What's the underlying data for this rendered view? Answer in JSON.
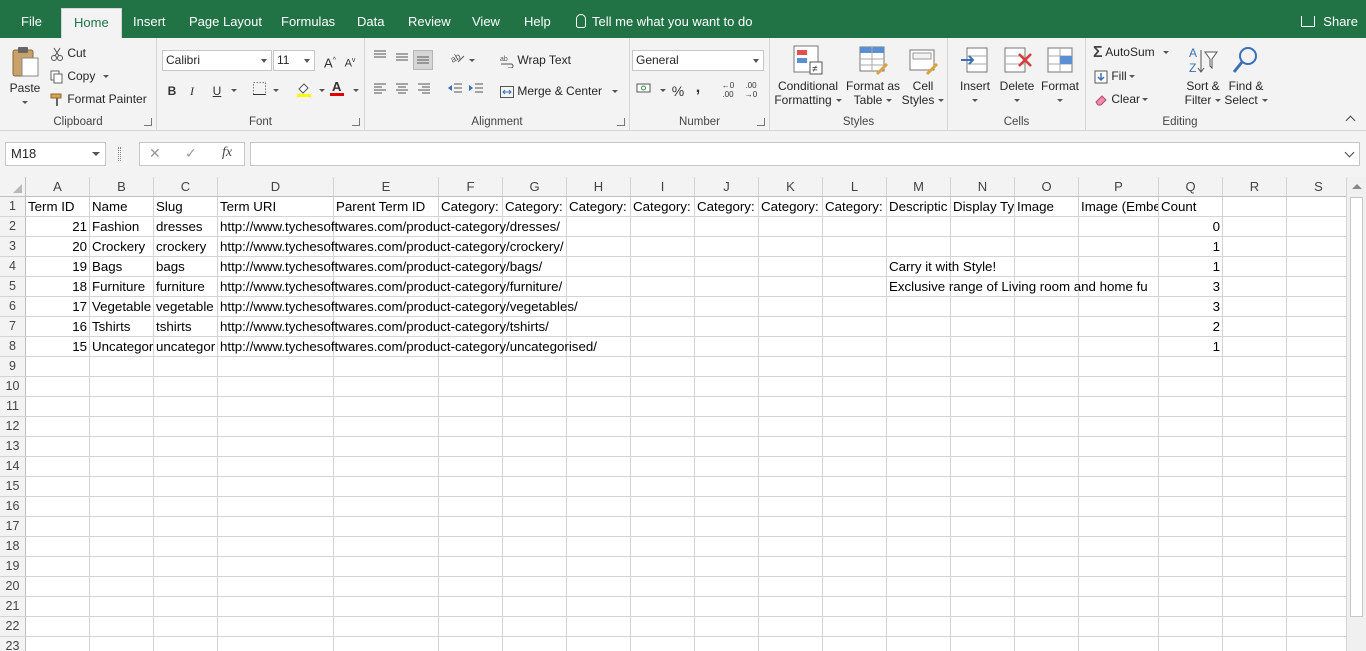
{
  "tabs": [
    "File",
    "Home",
    "Insert",
    "Page Layout",
    "Formulas",
    "Data",
    "Review",
    "View",
    "Help"
  ],
  "active_tab": "Home",
  "tell_me": "Tell me what you want to do",
  "share": "Share",
  "ribbon": {
    "clipboard": {
      "label": "Clipboard",
      "paste": "Paste",
      "cut": "Cut",
      "copy": "Copy",
      "format_painter": "Format Painter"
    },
    "font": {
      "label": "Font",
      "font_name": "Calibri",
      "font_size": "11",
      "bold": "B",
      "italic": "I",
      "underline": "U"
    },
    "alignment": {
      "label": "Alignment",
      "wrap_text": "Wrap Text",
      "merge_center": "Merge & Center"
    },
    "number": {
      "label": "Number",
      "format": "General",
      "percent": "%",
      "comma": ","
    },
    "styles": {
      "label": "Styles",
      "conditional_1": "Conditional",
      "conditional_2": "Formatting",
      "format_table_1": "Format as",
      "format_table_2": "Table",
      "cell_styles_1": "Cell",
      "cell_styles_2": "Styles"
    },
    "cells": {
      "label": "Cells",
      "insert": "Insert",
      "delete": "Delete",
      "format": "Format"
    },
    "editing": {
      "label": "Editing",
      "autosum": "AutoSum",
      "fill": "Fill",
      "clear": "Clear",
      "sort_1": "Sort &",
      "sort_2": "Filter",
      "find_1": "Find &",
      "find_2": "Select"
    }
  },
  "formula_bar": {
    "name_box": "M18",
    "fx": "fx",
    "content": ""
  },
  "columns": [
    "A",
    "B",
    "C",
    "D",
    "E",
    "F",
    "G",
    "H",
    "I",
    "J",
    "K",
    "L",
    "M",
    "N",
    "O",
    "P",
    "Q",
    "R",
    "S"
  ],
  "row_numbers": [
    "1",
    "2",
    "3",
    "4",
    "5",
    "6",
    "7",
    "8",
    "9",
    "10",
    "11",
    "12",
    "13",
    "14",
    "15",
    "16",
    "17",
    "18",
    "19",
    "20",
    "21",
    "22",
    "23"
  ],
  "sheet": {
    "headers": [
      "Term ID",
      "Name",
      "Slug",
      "Term URI",
      "Parent Term ID",
      "Category:",
      "Category:",
      "Category:",
      "Category:",
      "Category:",
      "Category:",
      "Category:",
      "Descriptic",
      "Display Ty",
      "Image",
      "Image (Embe",
      "Count"
    ],
    "rows": [
      {
        "id": "21",
        "name": "Fashion",
        "slug": "dresses",
        "uri": "http://www.tychesoftwares.com/product-category/dresses/",
        "desc": "",
        "count": "0"
      },
      {
        "id": "20",
        "name": "Crockery",
        "slug": "crockery",
        "uri": "http://www.tychesoftwares.com/product-category/crockery/",
        "desc": "",
        "count": "1"
      },
      {
        "id": "19",
        "name": "Bags",
        "slug": "bags",
        "uri": "http://www.tychesoftwares.com/product-category/bags/",
        "desc": "Carry it with Style!",
        "count": "1"
      },
      {
        "id": "18",
        "name": "Furniture",
        "slug": "furniture",
        "uri": "http://www.tychesoftwares.com/product-category/furniture/",
        "desc": "Exclusive range of Living room and home fu",
        "count": "3"
      },
      {
        "id": "17",
        "name": "Vegetable",
        "slug": "vegetable",
        "uri": "http://www.tychesoftwares.com/product-category/vegetables/",
        "desc": "",
        "count": "3"
      },
      {
        "id": "16",
        "name": "Tshirts",
        "slug": "tshirts",
        "uri": "http://www.tychesoftwares.com/product-category/tshirts/",
        "desc": "",
        "count": "2"
      },
      {
        "id": "15",
        "name": "Uncategor",
        "slug": "uncategor",
        "uri": "http://www.tychesoftwares.com/product-category/uncategorised/",
        "desc": "",
        "count": "1"
      }
    ]
  },
  "colors": {
    "accent": "#217346",
    "ribbon_bg": "#f3f3f3",
    "gridline": "#d4d4d4"
  }
}
